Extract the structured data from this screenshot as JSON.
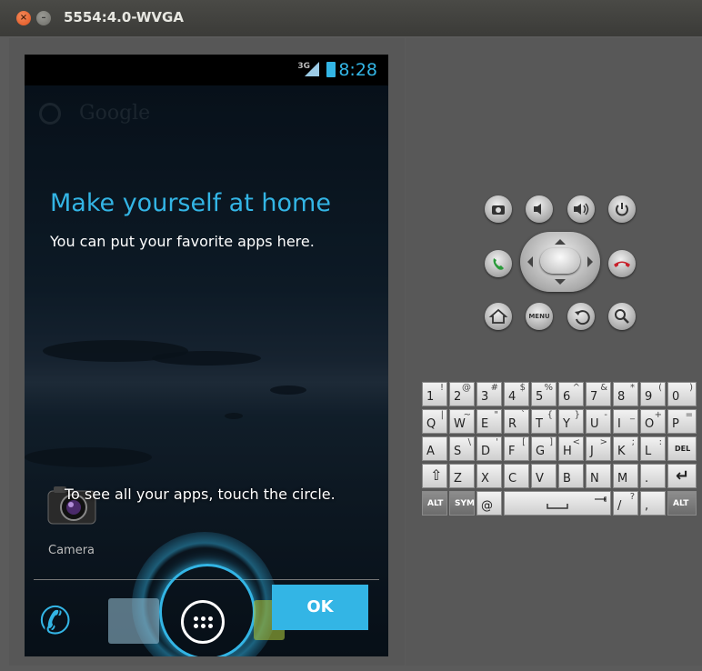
{
  "window": {
    "title": "5554:4.0-WVGA",
    "close_icon": "close-icon",
    "minimize_icon": "minimize-icon"
  },
  "statusbar": {
    "network": "3G",
    "time": "8:28"
  },
  "home": {
    "search_placeholder": "Google",
    "heading": "Make yourself at home",
    "subheading": "You can put your favorite apps here.",
    "camera_label": "Camera",
    "apps_hint": "To see all your apps, touch the circle.",
    "ok_label": "OK"
  },
  "controls": {
    "row1": [
      "camera-icon",
      "volume-down-icon",
      "volume-up-icon",
      "power-icon"
    ],
    "row3": [
      "home-icon",
      "menu-icon",
      "back-icon",
      "search-icon"
    ],
    "menu_label": "MENU"
  },
  "keyboard": {
    "rows": [
      [
        [
          "1",
          "!"
        ],
        [
          "2",
          "@"
        ],
        [
          "3",
          "#"
        ],
        [
          "4",
          "$"
        ],
        [
          "5",
          "%"
        ],
        [
          "6",
          "^"
        ],
        [
          "7",
          "&"
        ],
        [
          "8",
          "*"
        ],
        [
          "9",
          "("
        ],
        [
          "0",
          ")"
        ]
      ],
      [
        [
          "Q",
          "|"
        ],
        [
          "W",
          "~"
        ],
        [
          "E",
          "\""
        ],
        [
          "R",
          "`"
        ],
        [
          "T",
          "{"
        ],
        [
          "Y",
          "}"
        ],
        [
          "U",
          "-"
        ],
        [
          "I",
          "_"
        ],
        [
          "O",
          "+"
        ],
        [
          "P",
          "="
        ]
      ],
      [
        [
          "A",
          ""
        ],
        [
          "S",
          "\\"
        ],
        [
          "D",
          "'"
        ],
        [
          "F",
          "["
        ],
        [
          "G",
          "]"
        ],
        [
          "H",
          "<"
        ],
        [
          "J",
          ">"
        ],
        [
          "K",
          ";"
        ],
        [
          "L",
          ":"
        ],
        [
          "DEL",
          ""
        ]
      ],
      [
        [
          "⇧",
          ""
        ],
        [
          "Z",
          ""
        ],
        [
          "X",
          ""
        ],
        [
          "C",
          ""
        ],
        [
          "V",
          ""
        ],
        [
          "B",
          ""
        ],
        [
          "N",
          ""
        ],
        [
          "M",
          ""
        ],
        [
          ".",
          ""
        ],
        [
          "↵",
          ""
        ]
      ],
      [
        [
          "ALT",
          ""
        ],
        [
          "SYM",
          ""
        ],
        [
          "@",
          ""
        ],
        [
          "",
          ""
        ],
        [
          "/",
          "?"
        ],
        [
          ",",
          ""
        ],
        [
          "ALT",
          ""
        ]
      ]
    ]
  }
}
